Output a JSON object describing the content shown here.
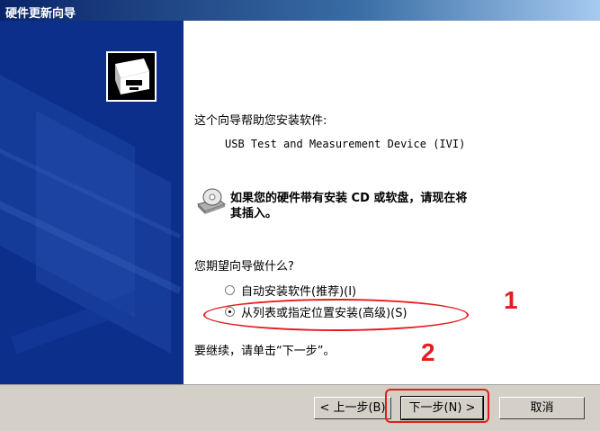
{
  "window": {
    "title": "硬件更新向导"
  },
  "wizard": {
    "intro": "这个向导帮助您安装软件:",
    "device_name": "USB Test and Measurement Device (IVI)",
    "cd_hint": "如果您的硬件带有安装 CD 或软盘，请现在将其插入。",
    "cd_hint_line1": "如果您的硬件带有安装 CD 或软盘，请现在将",
    "cd_hint_line2": "其插入。",
    "question": "您期望向导做什么?",
    "option_auto": "自动安装软件(推荐)(I)",
    "option_list": "从列表或指定位置安装(高级)(S)",
    "selected_option": "option_list",
    "continue_text": "要继续，请单击“下一步”。"
  },
  "buttons": {
    "back": "< 上一步(B)",
    "next": "下一步(N) >",
    "cancel": "取消"
  },
  "annotations": {
    "mark1": "1",
    "mark2": "2"
  },
  "colors": {
    "annotation": "#e31d1d",
    "banner": "#0b2f8a",
    "dialog_bg": "#d4d0c8"
  }
}
